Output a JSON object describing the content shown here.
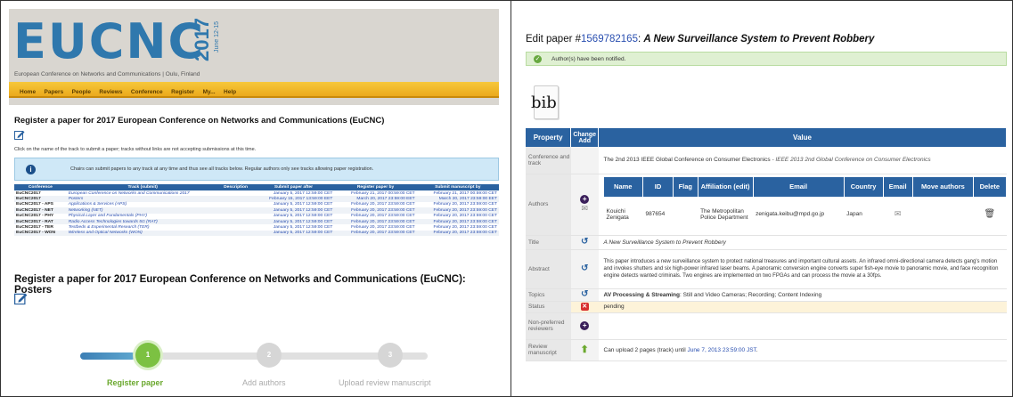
{
  "left": {
    "logo_text": "EUCNC",
    "logo_year": "2017",
    "logo_dates": "June 12-15",
    "subtitle": "European Conference on Networks and Communications | Oulu, Finland",
    "nav": [
      "Home",
      "Papers",
      "People",
      "Reviews",
      "Conference",
      "Register",
      "My...",
      "Help"
    ],
    "register_title_1": "Register a paper for 2017 European Conference on Networks and Communications (EuCNC)",
    "instructions": "Click on the name of the track to submit a paper; tracks without links are not accepting submissions at this time.",
    "info_text": "Chairs can submit papers to any track at any time and thus see all tracks below. Regular authors only see tracks allowing paper registration.",
    "table_headers": [
      "Conference",
      "Track (submit)",
      "Description",
      "Submit paper after",
      "Register paper by",
      "Submit manuscript by"
    ],
    "table_rows": [
      [
        "EuCNC2017",
        "European Conference on Networks and Communications 2017",
        "",
        "January 5, 2017 12:59:00 CET",
        "February 21, 2017 00:59:00 CET",
        "February 21, 2017 00:59:00 CET"
      ],
      [
        "EuCNC2017",
        "Posters",
        "",
        "February 15, 2017 13:59:00 EET",
        "March 20, 2017 23:59:00 EET",
        "March 20, 2017 23:59:00 EET"
      ],
      [
        "EuCNC2017 - APS",
        "Applications & Services (APS)",
        "",
        "January 5, 2017 12:59:00 CET",
        "February 20, 2017 23:59:00 CET",
        "February 20, 2017 23:59:00 CET"
      ],
      [
        "EuCNC2017 - NET",
        "Networking (NET)",
        "",
        "January 5, 2017 12:59:00 CET",
        "February 20, 2017 23:59:00 CET",
        "February 20, 2017 23:59:00 CET"
      ],
      [
        "EuCNC2017 - PHY",
        "Physical Layer and Fundamentals (PHY)",
        "",
        "January 5, 2017 12:59:00 CET",
        "February 20, 2017 23:59:00 CET",
        "February 20, 2017 23:59:00 CET"
      ],
      [
        "EuCNC2017 - RAT",
        "Radio Access Technologies towards 5G (RAT)",
        "",
        "January 5, 2017 12:59:00 CET",
        "February 20, 2017 23:59:00 CET",
        "February 20, 2017 23:59:00 CET"
      ],
      [
        "EuCNC2017 - TER",
        "Testbeds & Experimental Research (TER)",
        "",
        "January 5, 2017 12:59:00 CET",
        "February 20, 2017 23:59:00 CET",
        "February 20, 2017 23:59:00 CET"
      ],
      [
        "EuCNC2017 - WON",
        "Wireless and Optical Networks (WON)",
        "",
        "January 5, 2017 12:59:00 CET",
        "February 20, 2017 23:59:00 CET",
        "February 20, 2017 23:59:00 CET"
      ]
    ],
    "register_title_2": "Register a paper for 2017 European Conference on Networks and Communications (EuCNC): Posters",
    "wizard": [
      {
        "num": "1",
        "label": "Register paper"
      },
      {
        "num": "2",
        "label": "Add authors"
      },
      {
        "num": "3",
        "label": "Upload review manuscript"
      }
    ]
  },
  "right": {
    "edit_prefix": "Edit paper #",
    "paper_id": "1569782165",
    "paper_title": "A New Surveillance System to Prevent Robbery",
    "notified": "Author(s) have been notified.",
    "bib_label": "bib",
    "headers": {
      "property": "Property",
      "change": "Change Add",
      "value": "Value"
    },
    "conference": {
      "label": "Conference and track",
      "value_bold": "The 2nd 2013 IEEE Global Conference on Consumer Electronics",
      "value_rest": " - IEEE 2013 2nd Global Conference on Consumer Electronics"
    },
    "authors": {
      "label": "Authors",
      "headers": [
        "Name",
        "ID",
        "Flag",
        "Affiliation (edit)",
        "Email",
        "Country",
        "Email",
        "Move authors",
        "Delete"
      ],
      "name": "Kouichi Zenigata",
      "id": "987654",
      "affiliation": "The Metropolitan Police Department",
      "email": "zenigata.keibu@mpd.go.jp",
      "country": "Japan"
    },
    "title": {
      "label": "Title",
      "value": "A New Surveillance System to Prevent Robbery"
    },
    "abstract": {
      "label": "Abstract",
      "value": "This paper introduces a new surveillance system to protect national treasures and important cultural assets. An infrared omni-directional camera detects gang's motion and invokes shutters and six high-power infrared laser beams. A panoramic conversion engine converts super fish-eye movie to panoramic movie, and face recognition engine detects wanted criminals. Two engines are implemented on two FPGAs and can process the movie at a 30fps."
    },
    "topics": {
      "label": "Topics",
      "value_bold": "AV Processing & Streaming",
      "value_rest": ": Still and Video Cameras; Recording; Content Indexing"
    },
    "status": {
      "label": "Status",
      "value": "pending"
    },
    "nonpref": {
      "label": "Non-preferred reviewers",
      "value": ""
    },
    "review": {
      "label": "Review manuscript",
      "value_prefix": "Can upload 2 pages (track) until ",
      "value_link": "June 7, 2013 23:59:00 JST",
      "value_suffix": "."
    }
  },
  "colors": {
    "accent_blue": "#2a62a0",
    "nav_orange": "#f0b62a",
    "wizard_green": "#7cc142",
    "wizard_blue": "#4a8fc0",
    "wizard_grey": "#d6d6d6"
  }
}
